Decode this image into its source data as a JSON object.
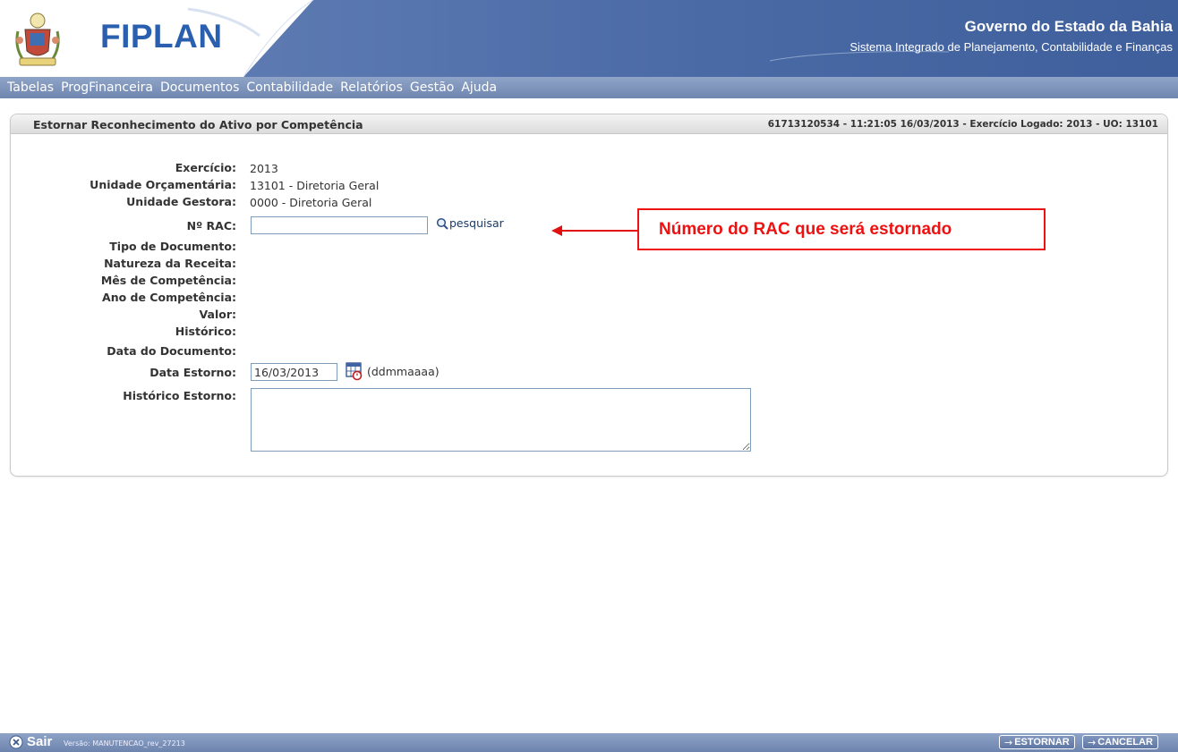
{
  "header": {
    "logo_text": "FIPLAN",
    "gov_title": "Governo do Estado da Bahia",
    "gov_subtitle": "Sistema Integrado de Planejamento, Contabilidade e Finanças"
  },
  "menu": {
    "items": [
      {
        "label": "Tabelas"
      },
      {
        "label": "ProgFinanceira"
      },
      {
        "label": "Documentos"
      },
      {
        "label": "Contabilidade"
      },
      {
        "label": "Relatórios"
      },
      {
        "label": "Gestão"
      },
      {
        "label": "Ajuda"
      }
    ]
  },
  "panel": {
    "title": "Estornar Reconhecimento do Ativo por Competência",
    "info": "61713120534 - 11:21:05 16/03/2013 - Exercício Logado: 2013 - UO: 13101"
  },
  "form": {
    "exercicio_label": "Exercício:",
    "exercicio_value": "2013",
    "uo_label": "Unidade Orçamentária:",
    "uo_value": "13101 - Diretoria Geral",
    "ug_label": "Unidade Gestora:",
    "ug_value": "0000 - Diretoria Geral",
    "rac_label": "Nº RAC:",
    "rac_value": "",
    "search_label": "pesquisar",
    "tipo_label": "Tipo de Documento:",
    "natureza_label": "Natureza da Receita:",
    "mes_label": "Mês de Competência:",
    "ano_label": "Ano de Competência:",
    "valor_label": "Valor:",
    "historico_label": "Histórico:",
    "data_doc_label": "Data do Documento:",
    "data_estorno_label": "Data Estorno:",
    "data_estorno_value": "16/03/2013",
    "date_hint": "(ddmmaaaa)",
    "hist_estorno_label": "Histórico Estorno:",
    "hist_estorno_value": ""
  },
  "annotation": {
    "text": "Número do RAC que será estornado",
    "color": "#e11111"
  },
  "footer": {
    "exit_label": "Sair",
    "version": "Versão: MANUTENCAO_rev_27213",
    "estornar_label": "ESTORNAR",
    "cancelar_label": "CANCELAR"
  },
  "colors": {
    "header_blue": "#4f6faa",
    "menu_bar": "#7d93bc",
    "logo_blue": "#2a5fb0",
    "annotation_red": "#e11111"
  }
}
